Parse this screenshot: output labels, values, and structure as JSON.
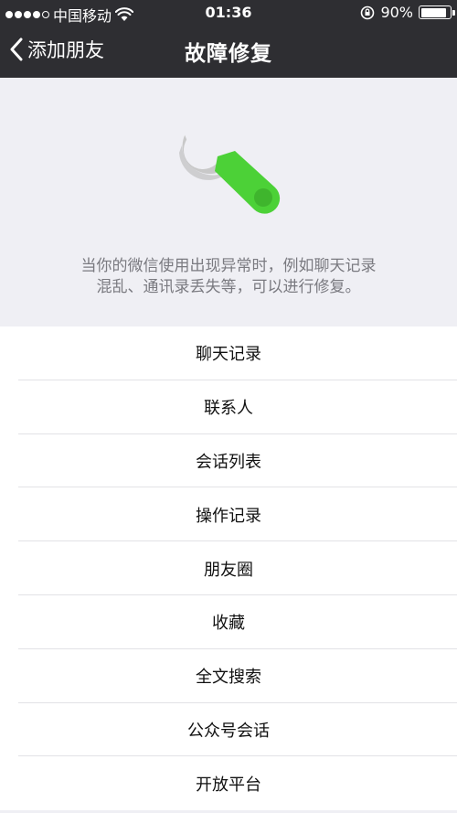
{
  "status_bar": {
    "carrier": "中国移动",
    "time": "01:36",
    "battery_percent": "90%",
    "battery_level": 0.9,
    "icons": [
      "signal-dots-icon",
      "wifi-icon",
      "rotation-lock-icon",
      "battery-icon"
    ]
  },
  "nav": {
    "back_label": "添加朋友",
    "title": "故障修复"
  },
  "hero": {
    "icon": "wrench-icon",
    "description_line1": "当你的微信使用出现异常时，例如聊天记录",
    "description_line2": "混乱、通讯录丢失等，可以进行修复。"
  },
  "repair_options": [
    {
      "label": "聊天记录"
    },
    {
      "label": "联系人"
    },
    {
      "label": "会话列表"
    },
    {
      "label": "操作记录"
    },
    {
      "label": "朋友圈"
    },
    {
      "label": "收藏"
    },
    {
      "label": "全文搜索"
    },
    {
      "label": "公众号会话"
    },
    {
      "label": "开放平台"
    }
  ],
  "colors": {
    "header_bg": "#2e2e32",
    "page_bg": "#efeff4",
    "wrench_gray": "#c8c8c8",
    "wrench_green": "#4cd137"
  }
}
